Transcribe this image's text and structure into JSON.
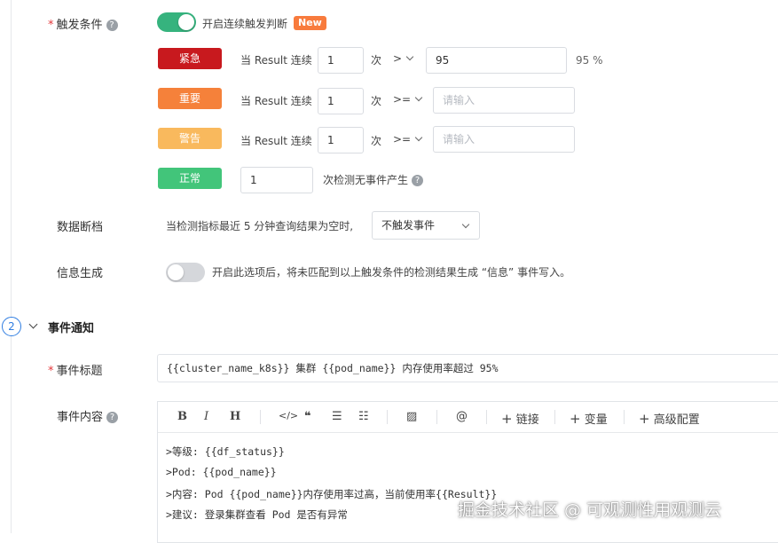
{
  "trigger": {
    "label": "触发条件",
    "required_mark": "*",
    "continuous_toggle": {
      "on": true,
      "label": "开启连续触发判断",
      "badge": "New"
    },
    "rows": [
      {
        "level": "紧急",
        "color": "#c8191e",
        "prefix": "当 Result 连续",
        "count": "1",
        "unit": "次",
        "operator": ">",
        "value": "95",
        "placeholder": "",
        "suffix": "95 %"
      },
      {
        "level": "重要",
        "color": "#f5813a",
        "prefix": "当 Result 连续",
        "count": "1",
        "unit": "次",
        "operator": ">=",
        "value": "",
        "placeholder": "请输入",
        "suffix": ""
      },
      {
        "level": "警告",
        "color": "#f9b95d",
        "prefix": "当 Result 连续",
        "count": "1",
        "unit": "次",
        "operator": ">=",
        "value": "",
        "placeholder": "请输入",
        "suffix": ""
      }
    ],
    "normal": {
      "level": "正常",
      "color": "#42c57a",
      "count": "1",
      "text": "次检测无事件产生"
    }
  },
  "data_gap": {
    "label": "数据断档",
    "text": "当检测指标最近 5 分钟查询结果为空时,",
    "select_value": "不触发事件"
  },
  "info_gen": {
    "label": "信息生成",
    "toggle_on": false,
    "text": "开启此选项后，将未匹配到以上触发条件的检测结果生成 “信息” 事件写入。"
  },
  "notify": {
    "step": "2",
    "title": "事件通知",
    "event_title_label": "事件标题",
    "event_title_value": "{{cluster_name_k8s}} 集群 {{pod_name}} 内存使用率超过 95%",
    "event_content_label": "事件内容",
    "toolbar": {
      "bold": "B",
      "italic": "I",
      "heading": "H",
      "code": "</>",
      "quote": "❝",
      "bullet": "☰",
      "ordered": "☷",
      "image": "▨",
      "mention": "@",
      "link": "链接",
      "variable": "变量",
      "advanced": "高级配置"
    },
    "content_lines": [
      ">等级: {{df_status}}",
      ">Pod: {{pod_name}}",
      ">内容: Pod  {{pod_name}}内存使用率过高，当前使用率{{Result}}",
      ">建议: 登录集群查看 Pod 是否有异常"
    ]
  },
  "watermark": "掘金技术社区 @ 可观测性用观测云"
}
